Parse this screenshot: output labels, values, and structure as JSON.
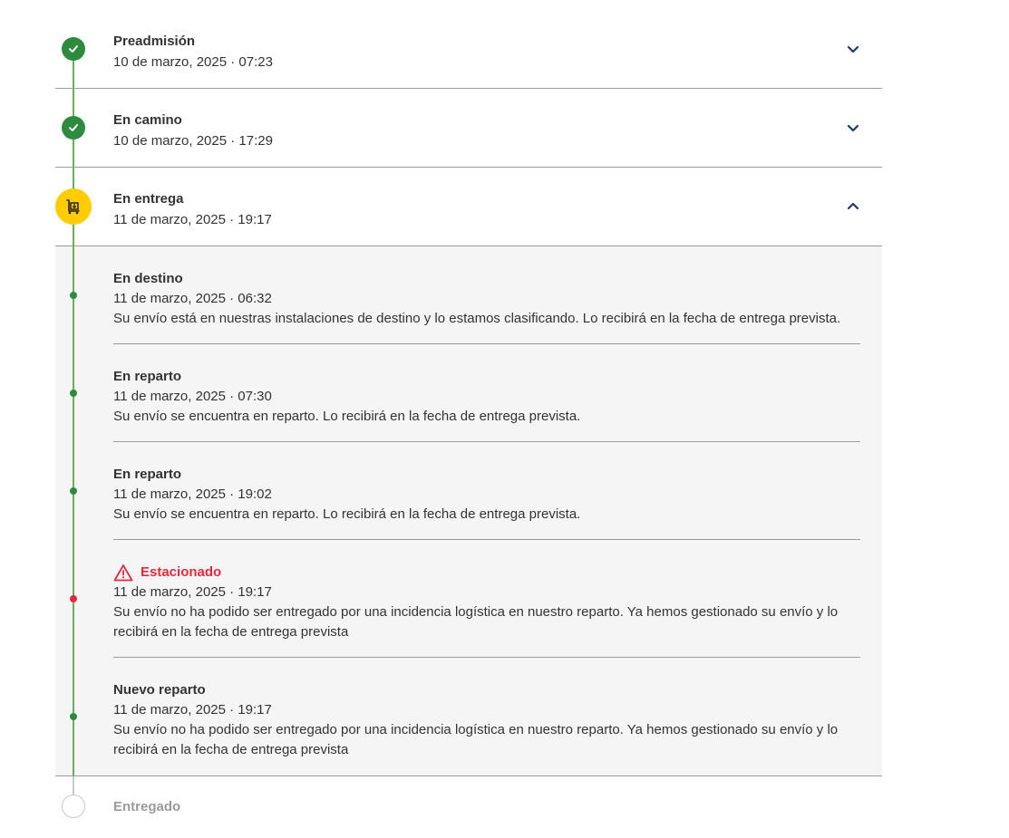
{
  "steps": [
    {
      "title": "Preadmisión",
      "date": "10 de marzo, 2025 · 07:23",
      "status": "done",
      "icon": "check-icon",
      "expanded": false
    },
    {
      "title": "En camino",
      "date": "10 de marzo, 2025 · 17:29",
      "status": "done",
      "icon": "check-icon",
      "expanded": false
    },
    {
      "title": "En entrega",
      "date": "11 de marzo, 2025 · 19:17",
      "status": "active",
      "icon": "delivery-cart-icon",
      "expanded": true
    },
    {
      "title": "Entregado",
      "date": "",
      "status": "pending",
      "icon": "empty-circle-icon",
      "expanded": false
    }
  ],
  "events": [
    {
      "title": "En destino",
      "date": "11 de marzo, 2025 · 06:32",
      "description": "Su envío está en nuestras instalaciones de destino y lo estamos clasificando. Lo recibirá en la fecha de entrega prevista.",
      "alert": false
    },
    {
      "title": "En reparto",
      "date": "11 de marzo, 2025 · 07:30",
      "description": "Su envío se encuentra en reparto. Lo recibirá en la fecha de entrega prevista.",
      "alert": false
    },
    {
      "title": "En reparto",
      "date": "11 de marzo, 2025 · 19:02",
      "description": "Su envío se encuentra en reparto. Lo recibirá en la fecha de entrega prevista.",
      "alert": false
    },
    {
      "title": "Estacionado",
      "date": "11 de marzo, 2025 · 19:17",
      "description": "Su envío no ha podido ser entregado por una incidencia logística en nuestro reparto. Ya hemos gestionado su envío y lo recibirá en la fecha de entrega prevista",
      "alert": true,
      "icon": "warning-icon"
    },
    {
      "title": "Nuevo reparto",
      "date": "11 de marzo, 2025 · 19:17",
      "description": "Su envío no ha podido ser entregado por una incidencia logística en nuestro reparto. Ya hemos gestionado su envío y lo recibirá en la fecha de entrega prevista",
      "alert": false
    }
  ],
  "colors": {
    "done": "#2e8b3e",
    "active": "#ffcc00",
    "alert": "#e12a3c",
    "line": "#6aae5a",
    "chevron": "#1a3a6b"
  }
}
